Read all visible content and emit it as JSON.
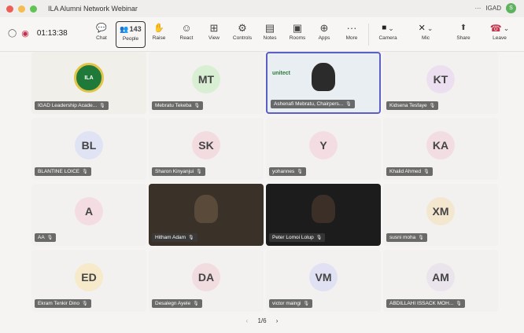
{
  "window": {
    "title": "ILA Alumni Network Webinar",
    "account": "IGAD",
    "avatar_initial": "S",
    "more": "···"
  },
  "meeting": {
    "timer": "01:13:38"
  },
  "toolbar": {
    "chat": "Chat",
    "people": "People",
    "people_count": "143",
    "raise": "Raise",
    "react": "React",
    "view": "View",
    "controls": "Controls",
    "notes": "Notes",
    "rooms": "Rooms",
    "apps": "Apps",
    "more": "More",
    "camera": "Camera",
    "mic": "Mic",
    "share": "Share",
    "leave": "Leave"
  },
  "participants": [
    {
      "name": "IGAD Leadership Acade...",
      "initials": "",
      "type": "logo",
      "logo_text": "ILA"
    },
    {
      "name": "Mebratu Tekeba",
      "initials": "MT",
      "color": "#d9efd4"
    },
    {
      "name": "Ashenafi Mebratu, Chairpers...",
      "initials": "",
      "type": "video",
      "active": true,
      "banner": "unitect"
    },
    {
      "name": "Kidsena Tesfaye",
      "initials": "KT",
      "color": "#ece0f0"
    },
    {
      "name": "BLANTINE LOICE",
      "initials": "BL",
      "color": "#dfe3f3"
    },
    {
      "name": "Sharon Kinyanjui",
      "initials": "SK",
      "color": "#f3dce0"
    },
    {
      "name": "yohannes",
      "initials": "Y",
      "color": "#f3dde3"
    },
    {
      "name": "Khalid Ahmed",
      "initials": "KA",
      "color": "#f1dde2"
    },
    {
      "name": "AA",
      "initials": "A",
      "color": "#f3dde3"
    },
    {
      "name": "Hitham Adam",
      "initials": "",
      "type": "video"
    },
    {
      "name": "Peter Lomoi Lolup",
      "initials": "",
      "type": "video"
    },
    {
      "name": "susni moha",
      "initials": "XM",
      "color": "#f4e7cf"
    },
    {
      "name": "Ekram Tenkir Dino",
      "initials": "ED",
      "color": "#f6eacb"
    },
    {
      "name": "Desalegn Ayele",
      "initials": "DA",
      "color": "#f1dce0"
    },
    {
      "name": "victor maingi",
      "initials": "VM",
      "color": "#e0e2f3"
    },
    {
      "name": "ABDILLAHI ISSACK MOH...",
      "initials": "AM",
      "color": "#eae4ed"
    }
  ],
  "pager": {
    "label": "1/6",
    "prev": "‹",
    "next": "›"
  },
  "colors": {
    "leave": "#c4314b",
    "active_border": "#5b5fc7"
  },
  "icons": {
    "shield": "◯",
    "record": "◉",
    "chat": "💬",
    "people": "👥",
    "raise": "✋",
    "react": "☺",
    "view": "⊞",
    "controls": "⚙",
    "notes": "▤",
    "rooms": "▣",
    "apps": "⊕",
    "more": "···",
    "camera": "■",
    "mic": "✕",
    "share": "⬆",
    "leave": "☎",
    "mic_off": "🎙",
    "hand": "✋",
    "chevron": "⌄"
  }
}
